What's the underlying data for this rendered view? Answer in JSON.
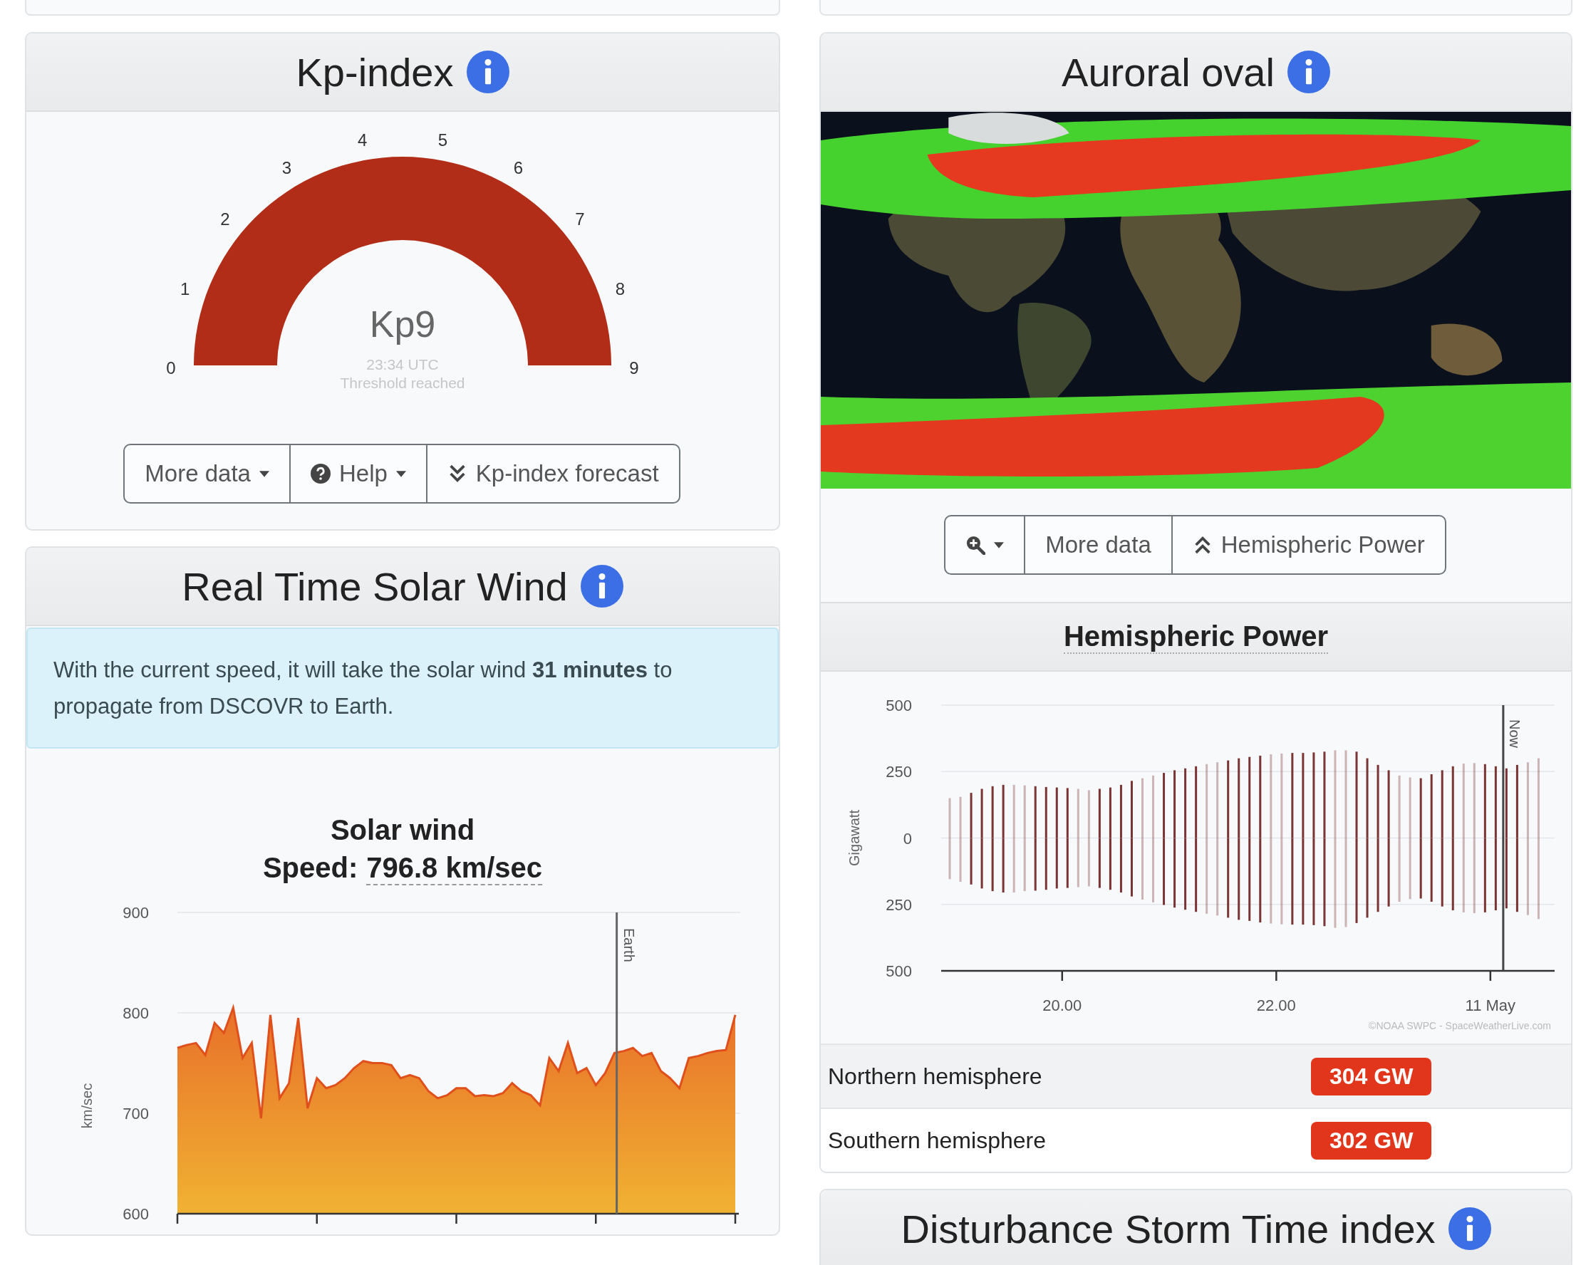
{
  "kp_card": {
    "title": "Kp-index",
    "gauge": {
      "value_text": "Kp9",
      "time": "23:34 UTC",
      "status": "Threshold reached",
      "scale": [
        "0",
        "1",
        "2",
        "3",
        "4",
        "5",
        "6",
        "7",
        "8",
        "9"
      ]
    },
    "buttons": [
      {
        "kind": "menu",
        "label": "More data"
      },
      {
        "kind": "help-menu",
        "label": "Help"
      },
      {
        "kind": "toggle-down",
        "label": "Kp-index forecast"
      }
    ]
  },
  "solar_wind_card": {
    "title": "Real Time Solar Wind",
    "alert": "With the current speed, it will take the solar wind **31 minutes** to propagate from DSCOVR to Earth.",
    "chart_title": "Solar wind",
    "speed_label": "Speed:",
    "speed_value": "796.8 km/sec",
    "chart_data": {
      "type": "area",
      "ylabel": "km/sec",
      "categories": [
        null,
        null,
        null,
        null,
        null,
        null,
        null,
        null,
        null,
        null,
        null,
        null,
        null,
        null,
        null,
        null,
        null,
        null,
        null,
        null,
        null,
        null,
        null,
        null,
        null,
        null,
        null,
        null,
        null,
        null,
        null,
        null,
        null,
        null,
        null,
        null,
        null,
        null,
        null,
        null,
        null,
        null,
        null,
        null,
        null,
        null,
        null,
        null,
        null,
        null,
        null,
        null,
        null,
        null,
        null,
        null,
        null,
        null,
        null,
        null,
        null
      ],
      "series": [
        {
          "color": "#e0501c",
          "values": [
            765,
            768,
            770,
            758,
            790,
            780,
            805,
            755,
            770,
            695,
            798,
            715,
            730,
            795,
            705,
            735,
            725,
            728,
            735,
            745,
            752,
            750,
            750,
            748,
            735,
            738,
            735,
            722,
            715,
            718,
            725,
            725,
            717,
            718,
            717,
            720,
            730,
            722,
            718,
            708,
            755,
            742,
            770,
            740,
            745,
            728,
            740,
            760,
            762,
            765,
            757,
            760,
            742,
            735,
            725,
            755,
            757,
            760,
            762,
            763,
            798
          ]
        }
      ],
      "ylim": [
        600,
        900
      ],
      "yticks": [
        600,
        700,
        800,
        900
      ],
      "grid": true,
      "annotations": [
        "Earth"
      ]
    }
  },
  "auroral_card": {
    "title": "Auroral oval",
    "buttons": [
      {
        "kind": "zoom-menu"
      },
      {
        "kind": "plain",
        "label": "More data"
      },
      {
        "kind": "toggle-up",
        "label": "Hemispheric Power"
      }
    ],
    "hemispheric_power": {
      "title": "Hemispheric Power",
      "chart_data": {
        "type": "bar",
        "ylabel": "Gigawatt",
        "stacked": true,
        "x": [
          18.95,
          19.05,
          19.15,
          19.25,
          19.35,
          19.45,
          19.55,
          19.65,
          19.75,
          19.85,
          19.95,
          20.05,
          20.15,
          20.25,
          20.35,
          20.45,
          20.55,
          20.65,
          20.75,
          20.85,
          20.95,
          21.05,
          21.15,
          21.25,
          21.35,
          21.45,
          21.55,
          21.65,
          21.75,
          21.85,
          21.95,
          22.05,
          22.15,
          22.25,
          22.35,
          22.45,
          22.55,
          22.65,
          22.75,
          22.85,
          22.95,
          23.05,
          23.15,
          23.25,
          23.35,
          23.45,
          23.55,
          23.65,
          23.75,
          23.85,
          23.95,
          24.05,
          24.15,
          24.25,
          24.35,
          24.45
        ],
        "series": [
          {
            "color": "#7a3434",
            "values": [
              150,
              155,
              170,
              185,
              195,
              200,
              200,
              198,
              195,
              192,
              190,
              188,
              185,
              180,
              185,
              190,
              200,
              215,
              225,
              235,
              245,
              255,
              262,
              270,
              278,
              285,
              292,
              300,
              305,
              310,
              315,
              318,
              320,
              320,
              322,
              325,
              330,
              330,
              325,
              300,
              275,
              255,
              235,
              228,
              225,
              240,
              255,
              270,
              280,
              282,
              278,
              270,
              262,
              275,
              285,
              300
            ]
          },
          {
            "color": "#7a3434",
            "values": [
              -155,
              -165,
              -175,
              -190,
              -200,
              -205,
              -205,
              -200,
              -198,
              -195,
              -190,
              -188,
              -185,
              -182,
              -188,
              -195,
              -205,
              -220,
              -232,
              -242,
              -252,
              -262,
              -270,
              -278,
              -285,
              -292,
              -300,
              -308,
              -312,
              -318,
              -322,
              -325,
              -326,
              -326,
              -328,
              -332,
              -338,
              -335,
              -320,
              -300,
              -278,
              -258,
              -240,
              -230,
              -228,
              -240,
              -258,
              -272,
              -280,
              -283,
              -280,
              -272,
              -265,
              -278,
              -290,
              -305
            ]
          }
        ],
        "xlim": [
          18.87,
          24.6
        ],
        "ylim": [
          -500,
          500
        ],
        "xticks": [
          {
            "value": 20,
            "label": "20.00"
          },
          {
            "value": 22,
            "label": "22.00"
          },
          {
            "value": 24,
            "label": "11 May"
          }
        ],
        "yticks": [
          {
            "value": -500,
            "label": "500"
          },
          {
            "value": -250,
            "label": "250"
          },
          0,
          250,
          500
        ],
        "grid": true,
        "ref_lines": [
          {
            "axis": "x",
            "value": 24.12,
            "label": "Now"
          }
        ]
      },
      "credit": "©NOAA SWPC - SpaceWeatherLive.com",
      "rows": [
        {
          "label": "Northern hemisphere",
          "value": "304 GW"
        },
        {
          "label": "Southern hemisphere",
          "value": "302 GW"
        }
      ]
    }
  },
  "dst_card": {
    "title": "Disturbance Storm Time index"
  }
}
